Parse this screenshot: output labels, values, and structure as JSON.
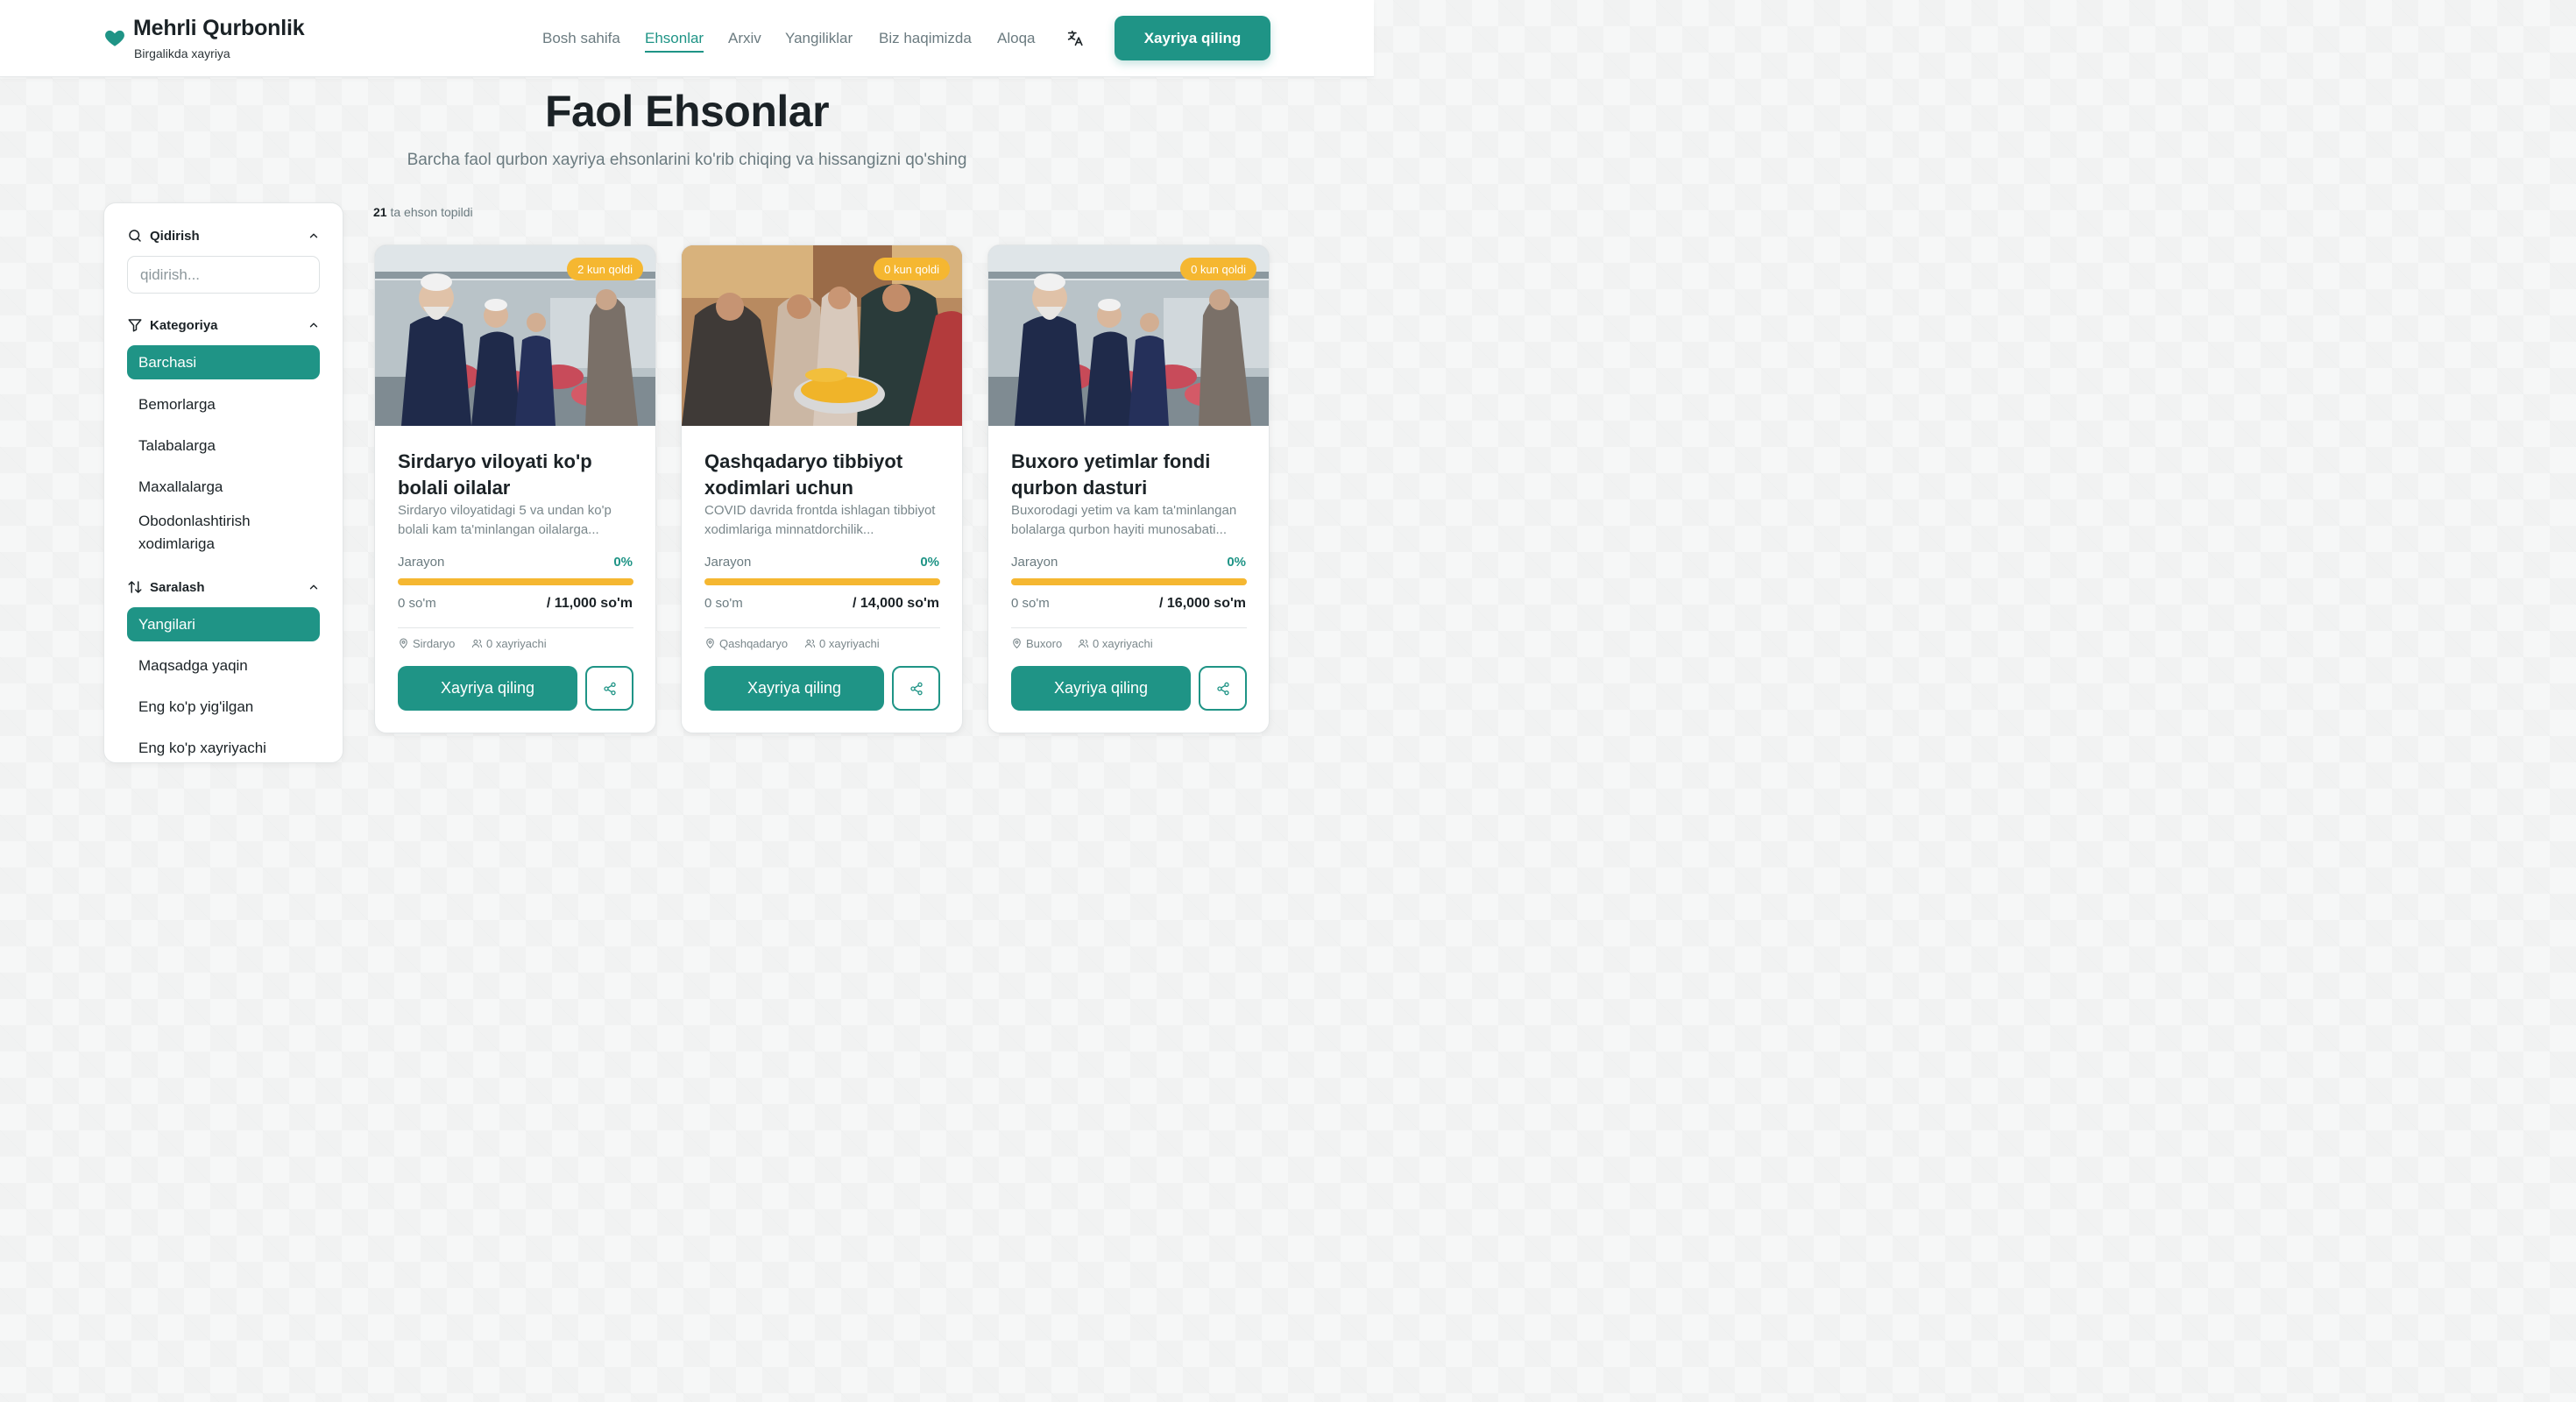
{
  "brand": {
    "title": "Mehrli Qurbonlik",
    "subtitle": "Birgalikda xayriya"
  },
  "nav": [
    {
      "label": "Bosh sahifa",
      "active": false
    },
    {
      "label": "Ehsonlar",
      "active": true
    },
    {
      "label": "Arxiv",
      "active": false
    },
    {
      "label": "Yangiliklar",
      "active": false
    },
    {
      "label": "Biz haqimizda",
      "active": false
    },
    {
      "label": "Aloqa",
      "active": false
    }
  ],
  "header_cta": "Xayriya qiling",
  "page": {
    "title": "Faol Ehsonlar",
    "subtitle": "Barcha faol qurbon xayriya ehsonlarini ko'rib chiqing va hissangizni qo'shing"
  },
  "sidebar": {
    "search": {
      "title": "Qidirish",
      "placeholder": "qidirish...",
      "value": ""
    },
    "category": {
      "title": "Kategoriya",
      "options": [
        "Barchasi",
        "Bemorlarga",
        "Talabalarga",
        "Maxallalarga",
        "Obodonlashtirish xodimlariga"
      ],
      "selected": "Barchasi"
    },
    "sort": {
      "title": "Saralash",
      "options": [
        "Yangilari",
        "Maqsadga yaqin",
        "Eng ko'p yig'ilgan",
        "Eng ko'p xayriyachi"
      ],
      "selected": "Yangilari"
    }
  },
  "results": {
    "count": "21",
    "label": "ta ehson topildi"
  },
  "cards": [
    {
      "badge": "2 kun qoldi",
      "title": "Sirdaryo viloyati ko'p bolali oilalar",
      "desc": "Sirdaryo viloyatidagi 5 va undan ko'p bolali kam ta'minlangan oilalarga...",
      "progress_label": "Jarayon",
      "progress_pct": "0%",
      "progress": 0,
      "raised": "0 so'm",
      "goal": "/ 11,000 so'm",
      "location": "Sirdaryo",
      "donors": "0 xayriyachi",
      "button": "Xayriya qiling",
      "image": "men-packing-meat"
    },
    {
      "badge": "0 kun qoldi",
      "title": "Qashqadaryo tibbiyot xodimlari uchun",
      "desc": "COVID davrida frontda ishlagan tibbiyot xodimlariga minnatdorchilik...",
      "progress_label": "Jarayon",
      "progress_pct": "0%",
      "progress": 0,
      "raised": "0 so'm",
      "goal": "/ 14,000 so'm",
      "location": "Qashqadaryo",
      "donors": "0 xayriyachi",
      "button": "Xayriya qiling",
      "image": "women-sharing-food"
    },
    {
      "badge": "0 kun qoldi",
      "title": "Buxoro yetimlar fondi qurbon dasturi",
      "desc": "Buxorodagi yetim va kam ta'minlangan bolalarga qurbon hayiti munosabati...",
      "progress_label": "Jarayon",
      "progress_pct": "0%",
      "progress": 0,
      "raised": "0 so'm",
      "goal": "/ 16,000 so'm",
      "location": "Buxoro",
      "donors": "0 xayriyachi",
      "button": "Xayriya qiling",
      "image": "men-packing-meat"
    }
  ],
  "colors": {
    "primary": "#1f9486",
    "accent": "#f5b731",
    "text": "#1b2226",
    "muted": "#6b7b80"
  }
}
